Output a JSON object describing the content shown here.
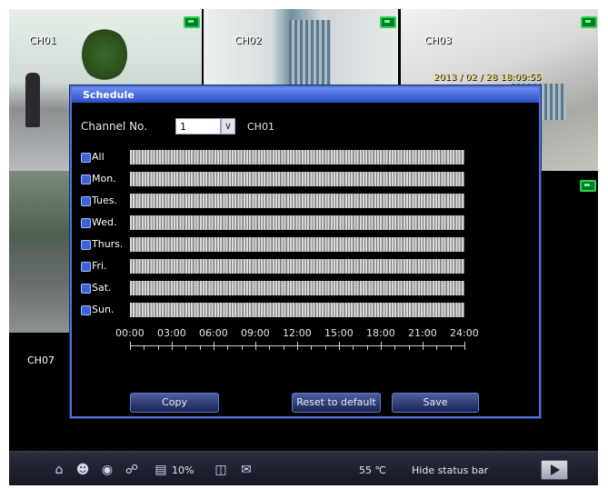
{
  "cameras": [
    {
      "label": "CH01"
    },
    {
      "label": "CH02"
    },
    {
      "label": "CH03",
      "timestamp": "2013 / 02 / 28 18:09:55"
    }
  ],
  "ch07_label": "CH07",
  "dialog": {
    "title": "Schedule",
    "channel_label": "Channel No.",
    "channel_value": "1",
    "channel_name": "CH01",
    "days": [
      "All",
      "Mon.",
      "Tues.",
      "Wed.",
      "Thurs.",
      "Fri.",
      "Sat.",
      "Sun."
    ],
    "time_ticks": [
      "00:00",
      "03:00",
      "06:00",
      "09:00",
      "12:00",
      "15:00",
      "18:00",
      "21:00",
      "24:00"
    ],
    "buttons": {
      "copy": "Copy",
      "reset": "Reset to default",
      "save": "Save"
    }
  },
  "statusbar": {
    "disk_usage": "10%",
    "temperature": "55 ℃",
    "hide_label": "Hide status bar",
    "icons": [
      "home-icon",
      "user-icon",
      "record-icon",
      "ptz-icon",
      "hdd-icon",
      "network-icon",
      "mail-icon",
      "play-icon"
    ]
  },
  "colors": {
    "dialog_border": "#4f73d8",
    "title_bar": "#3a5bd0",
    "rec_indicator": "#2fd34a"
  }
}
